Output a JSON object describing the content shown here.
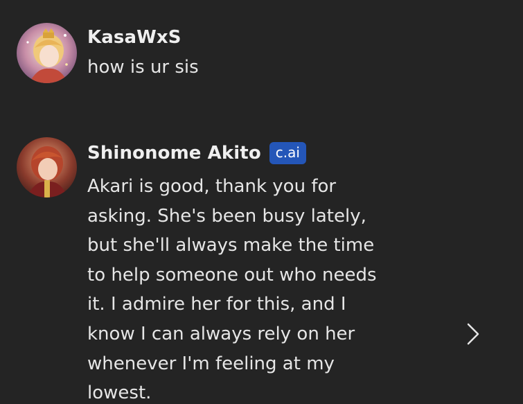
{
  "messages": [
    {
      "author": "KasaWxS",
      "avatar_icon": "user-avatar-icon",
      "text": "how is ur sis"
    },
    {
      "author": "Shinonome Akito",
      "badge": "c.ai",
      "avatar_icon": "character-avatar-icon",
      "text": "Akari is good, thank you for\nasking. She's been busy lately,\nbut she'll always make the time\nto help someone out who needs\nit. I admire her for this, and I\nknow I can always rely on her\nwhenever I'm feeling at my\nlowest."
    }
  ],
  "controls": {
    "next_icon": "chevron-right-icon"
  },
  "colors": {
    "background": "#242424",
    "text": "#e6e6e6",
    "badge": "#2456b8"
  }
}
